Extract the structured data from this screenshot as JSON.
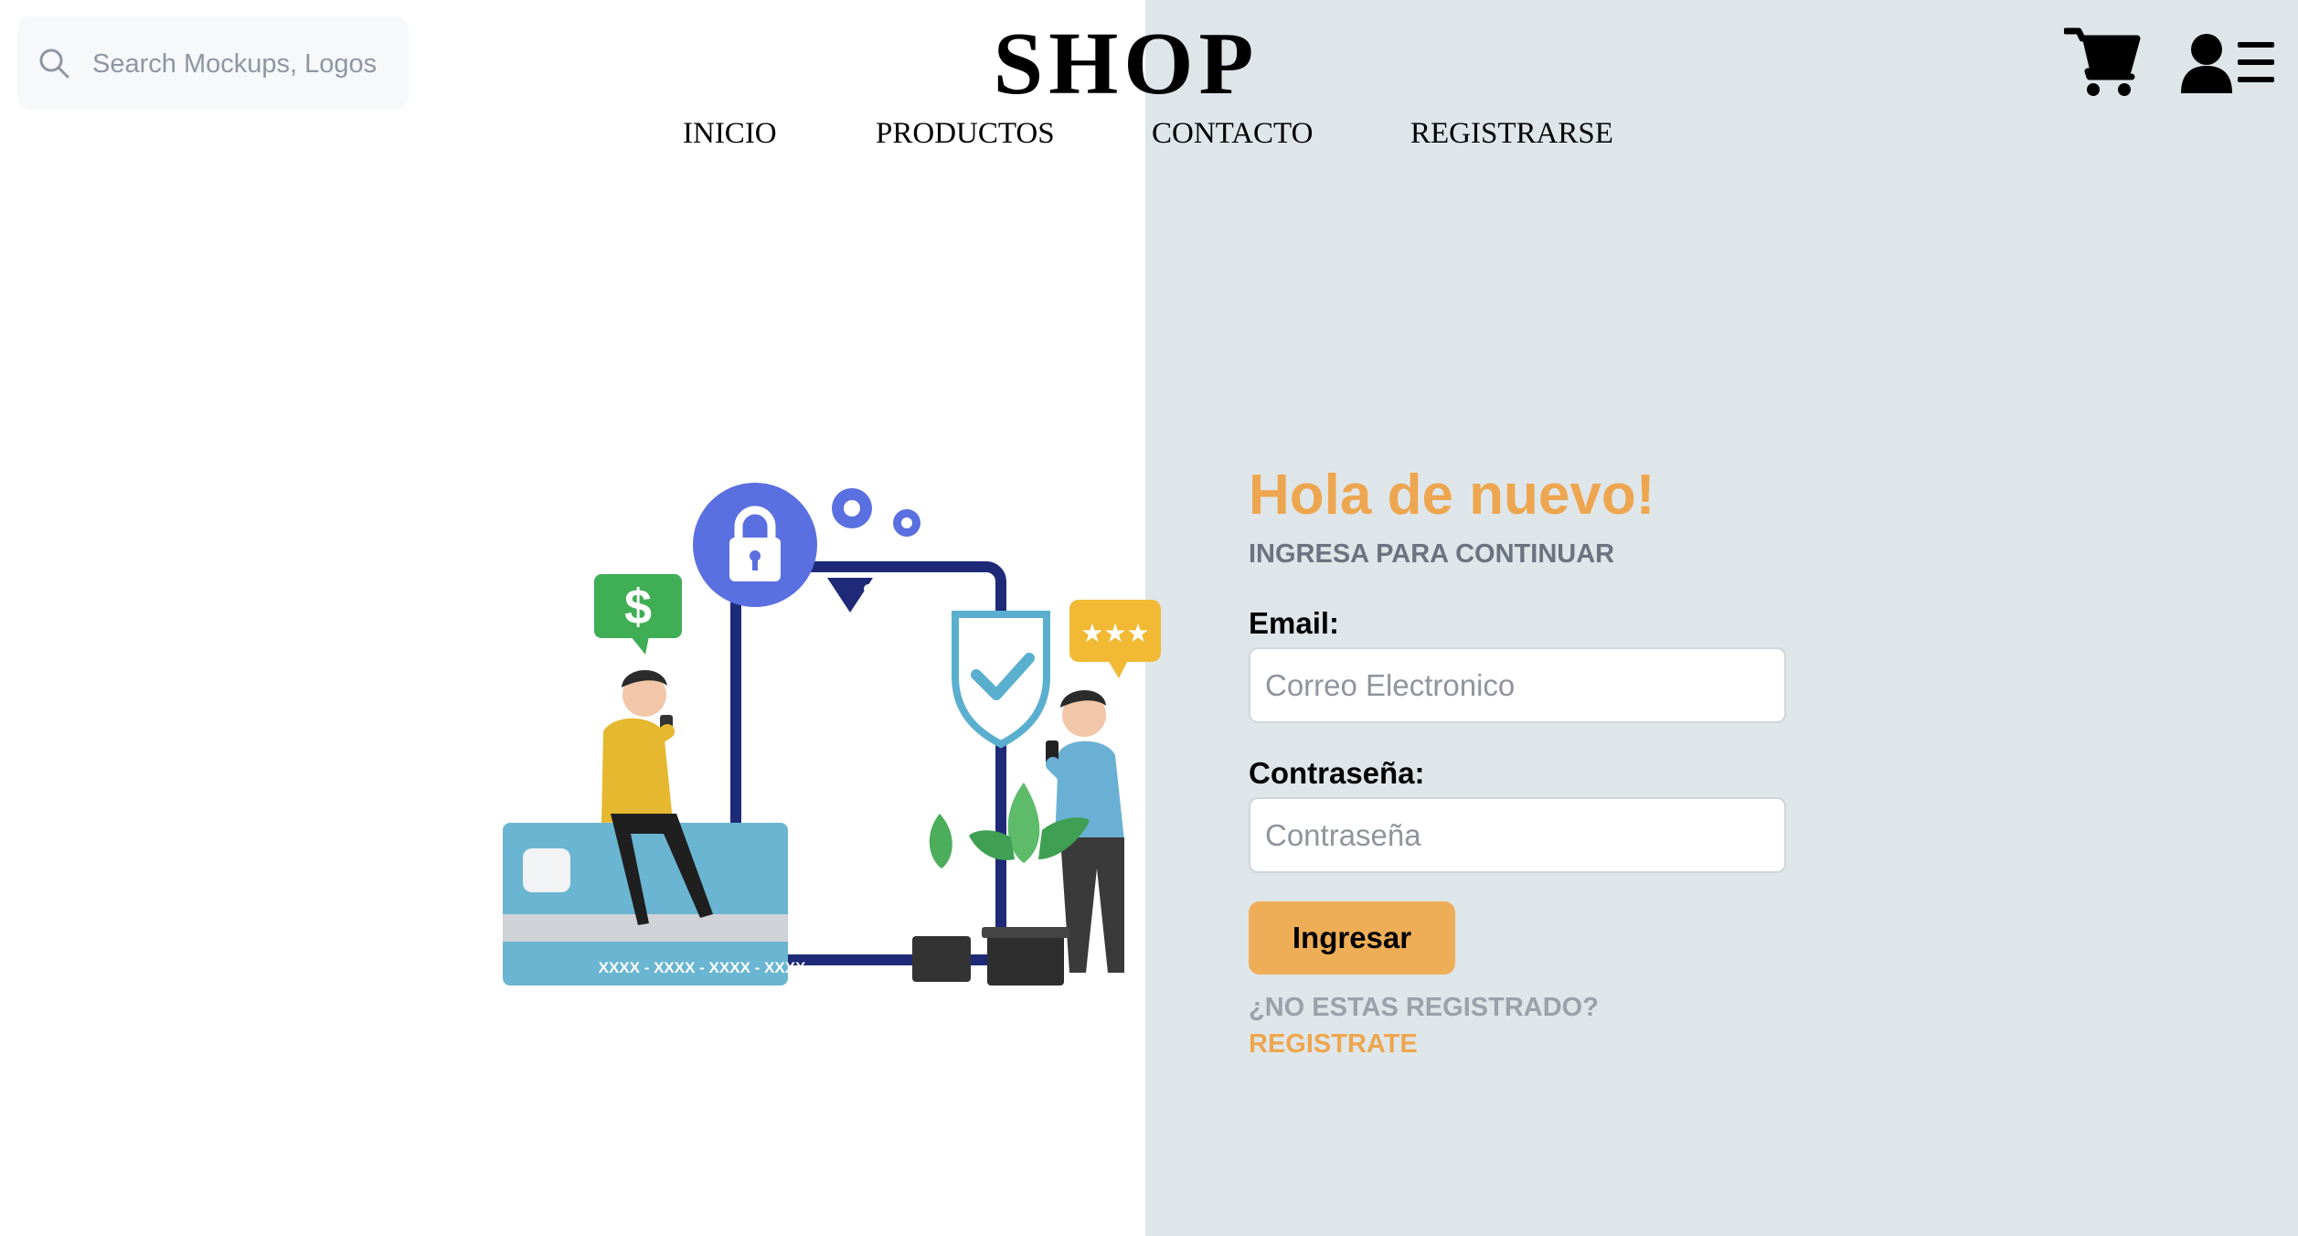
{
  "header": {
    "search_placeholder": "Search Mockups, Logos...",
    "logo": "SHOP",
    "nav": [
      {
        "label": "INICIO"
      },
      {
        "label": "PRODUCTOS"
      },
      {
        "label": "CONTACTO"
      },
      {
        "label": "REGISTRARSE"
      }
    ],
    "icons": [
      "search-icon",
      "cart-icon",
      "user-menu-icon"
    ]
  },
  "illustration": {
    "card_number": "XXXX - XXXX - XXXX - XXXX",
    "dollar_sign": "$"
  },
  "login": {
    "title": "Hola de nuevo!",
    "subtitle": "INGRESA PARA CONTINUAR",
    "email_label": "Email:",
    "email_placeholder": "Correo Electronico",
    "password_label": "Contraseña:",
    "password_placeholder": "Contraseña",
    "submit_label": "Ingresar",
    "no_account_text": "¿NO ESTAS REGISTRADO?",
    "register_link": "REGISTRATE"
  },
  "colors": {
    "accent": "#eda64f",
    "panel_bg": "#dfe6e9",
    "button_bg": "#eeae57"
  }
}
